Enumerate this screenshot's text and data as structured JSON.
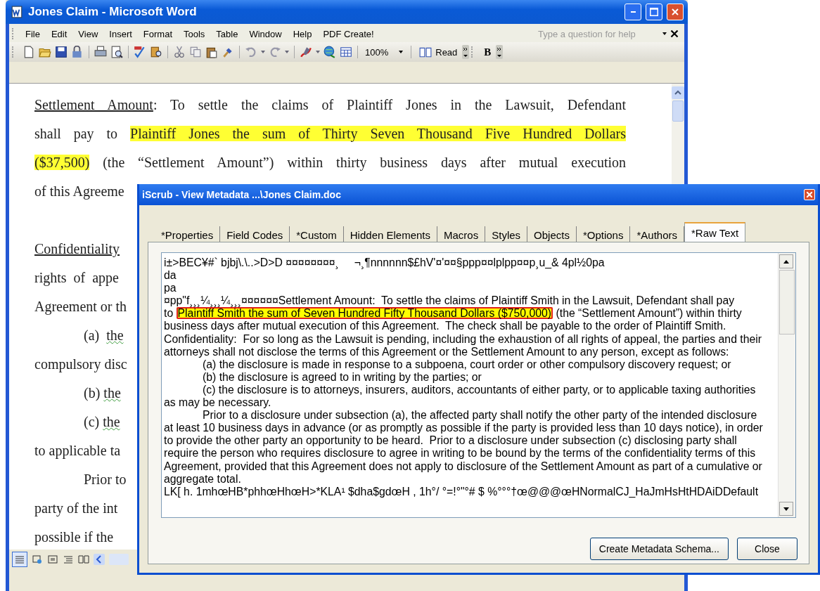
{
  "word_window": {
    "title": "Jones Claim - Microsoft Word",
    "menu": [
      "File",
      "Edit",
      "View",
      "Insert",
      "Format",
      "Tools",
      "Table",
      "Window",
      "Help",
      "PDF Create!"
    ],
    "help_search": {
      "placeholder": "Type a question for help"
    },
    "zoom": "100%",
    "read_button": "Read",
    "bold_button": "B",
    "document_lines": [
      {
        "kind": "justified",
        "runs": [
          {
            "text": "Settlement Amount",
            "kind": "underline"
          },
          {
            "text": ":  To settle the claims of Plaintiff Jones in the Lawsuit, Defendant",
            "kind": "plain"
          }
        ]
      },
      {
        "kind": "justified",
        "runs": [
          {
            "text": "shall pay to ",
            "kind": "plain"
          },
          {
            "text": "Plaintiff Jones the sum of Thirty Seven Thousand Five Hundred Dollars",
            "kind": "highlight"
          }
        ]
      },
      {
        "kind": "justified",
        "runs": [
          {
            "text": "($37,500)",
            "kind": "highlight"
          },
          {
            "text": " (the “Settlement Amount”) within thirty business days after mutual execution",
            "kind": "plain"
          }
        ]
      },
      {
        "kind": "plain",
        "runs": [
          {
            "text": "of this Agreeme",
            "kind": "plain"
          }
        ]
      },
      {
        "kind": "blank"
      },
      {
        "kind": "plain",
        "runs": [
          {
            "text": "Confidentiality",
            "kind": "underline"
          }
        ]
      },
      {
        "kind": "plain",
        "runs": [
          {
            "text": "rights  of  appe",
            "kind": "plain"
          }
        ]
      },
      {
        "kind": "plain",
        "runs": [
          {
            "text": "Agreement or th",
            "kind": "plain"
          }
        ]
      },
      {
        "kind": "indented",
        "runs": [
          {
            "text": "(a)  ",
            "kind": "plain"
          },
          {
            "text": "the",
            "kind": "squiggle"
          }
        ]
      },
      {
        "kind": "plain",
        "runs": [
          {
            "text": "compulsory disc",
            "kind": "plain"
          }
        ]
      },
      {
        "kind": "indented",
        "runs": [
          {
            "text": "(b) ",
            "kind": "plain"
          },
          {
            "text": "the",
            "kind": "squiggle"
          }
        ]
      },
      {
        "kind": "indented",
        "runs": [
          {
            "text": "(c) ",
            "kind": "plain"
          },
          {
            "text": "the",
            "kind": "squiggle"
          }
        ]
      },
      {
        "kind": "plain",
        "runs": [
          {
            "text": "to applicable ta",
            "kind": "plain"
          }
        ]
      },
      {
        "kind": "indented",
        "runs": [
          {
            "text": "Prior to",
            "kind": "plain"
          }
        ]
      },
      {
        "kind": "plain",
        "runs": [
          {
            "text": "party of the int",
            "kind": "plain"
          }
        ]
      },
      {
        "kind": "plain",
        "runs": [
          {
            "text": "possible if the",
            "kind": "plain"
          }
        ]
      }
    ]
  },
  "dialog": {
    "title": "iScrub - View Metadata ...\\Jones Claim.doc",
    "tabs": [
      {
        "label": "*Properties",
        "selected": false
      },
      {
        "label": "Field Codes",
        "selected": false
      },
      {
        "label": "*Custom",
        "selected": false
      },
      {
        "label": "Hidden Elements",
        "selected": false
      },
      {
        "label": "Macros",
        "selected": false
      },
      {
        "label": "Styles",
        "selected": false
      },
      {
        "label": "Objects",
        "selected": false
      },
      {
        "label": "*Options",
        "selected": false
      },
      {
        "label": "*Authors",
        "selected": false
      },
      {
        "label": "*Raw Text",
        "selected": true
      }
    ],
    "raw_text_lines": [
      {
        "kind": "plain",
        "runs": [
          {
            "text": "i±>BEC¥#` bjbj\\.\\..>D>D ¤¤¤¤¤¤¤¤¸     ¬¸¶nnnnnn$£hV'¤'¤¤§ppp¤¤lplpp¤¤p¸u_& 4pl½0pa"
          }
        ]
      },
      {
        "kind": "plain",
        "runs": [
          {
            "text": "da"
          }
        ]
      },
      {
        "kind": "plain",
        "runs": [
          {
            "text": "pa"
          }
        ]
      },
      {
        "kind": "plain",
        "runs": [
          {
            "text": "¤pp\"f¸¸¸¼¸¸¸¼¸¸¸¤¤¤¤¤¤Settlement Amount:  To settle the claims of Plaintiff Smith in the Lawsuit, Defendant shall pay"
          }
        ]
      },
      {
        "kind": "plain",
        "runs": [
          {
            "text": "to "
          },
          {
            "text": "Plaintiff Smith the sum of Seven Hundred Fifty Thousand Dollars ($750,000)",
            "kind": "boxed_highlight"
          },
          {
            "text": " (the “Settlement Amount”) within thirty"
          }
        ]
      },
      {
        "kind": "plain",
        "runs": [
          {
            "text": "business days after mutual execution of this Agreement.  The check shall be payable to the order of Plaintiff Smith."
          }
        ]
      },
      {
        "kind": "plain",
        "runs": [
          {
            "text": "Confidentiality:  For so long as the Lawsuit is pending, including the exhaustion of all rights of appeal, the parties and their"
          }
        ]
      },
      {
        "kind": "plain",
        "runs": [
          {
            "text": "attorneys shall not disclose the terms of this Agreement or the Settlement Amount to any person, except as follows:"
          }
        ]
      },
      {
        "kind": "indented",
        "runs": [
          {
            "text": "(a) the disclosure is made in response to a subpoena, court order or other compulsory discovery request; or"
          }
        ]
      },
      {
        "kind": "indented",
        "runs": [
          {
            "text": "(b) the disclosure is agreed to in writing by the parties; or"
          }
        ]
      },
      {
        "kind": "indented",
        "runs": [
          {
            "text": "(c) the disclosure is to attorneys, insurers, auditors, accountants of either party, or to applicable taxing authorities"
          }
        ]
      },
      {
        "kind": "plain",
        "runs": [
          {
            "text": "as may be necessary."
          }
        ]
      },
      {
        "kind": "indented",
        "runs": [
          {
            "text": "Prior to a disclosure under subsection (a), the affected party shall notify the other party of the intended disclosure"
          }
        ]
      },
      {
        "kind": "plain",
        "runs": [
          {
            "text": "at least 10 business days in advance (or as promptly as possible if the party is provided less than 10 days notice), in order"
          }
        ]
      },
      {
        "kind": "plain",
        "runs": [
          {
            "text": "to provide the other party an opportunity to be heard.  Prior to a disclosure under subsection (c) disclosing party shall"
          }
        ]
      },
      {
        "kind": "plain",
        "runs": [
          {
            "text": "require the person who requires disclosure to agree in writing to be bound by the terms of the confidentiality terms of this"
          }
        ]
      },
      {
        "kind": "plain",
        "runs": [
          {
            "text": "Agreement, provided that this Agreement does not apply to disclosure of the Settlement Amount as part of a cumulative or"
          }
        ]
      },
      {
        "kind": "plain",
        "runs": [
          {
            "text": "aggregate total."
          }
        ]
      },
      {
        "kind": "plain",
        "runs": [
          {
            "text": "LK[ h. 1mhœHB*phhœHhœH>*KLA¹ $dha$gdœH , 1h°/ °=!°\"°# $ %°°°†œ@@@œHNormalCJ_HaJmHsHtHDAiDDefault"
          }
        ]
      }
    ],
    "buttons": [
      "Create Metadata Schema...",
      "Close"
    ]
  }
}
